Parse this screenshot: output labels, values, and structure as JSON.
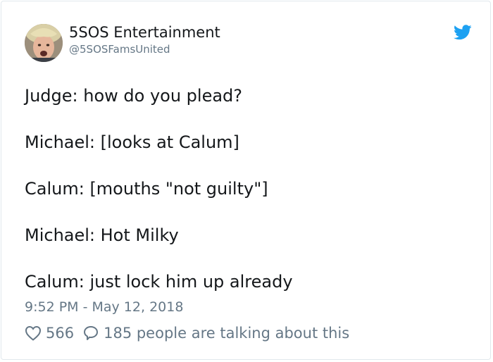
{
  "author": {
    "display_name": "5SOS Entertainment",
    "handle": "@5SOSFamsUnited",
    "avatar_icon": "avatar-photo",
    "brand_icon": "twitter-bird-icon",
    "brand_color": "#1da1f2"
  },
  "tweet": {
    "lines": [
      "Judge: how do you plead?",
      "Michael: [looks at Calum]",
      "Calum: [mouths \"not guilty\"]",
      "Michael: Hot Milky",
      "Calum: just lock him up already"
    ],
    "timestamp": "9:52 PM - May 12, 2018"
  },
  "actions": {
    "like_icon": "heart-icon",
    "like_count": "566",
    "reply_icon": "speech-bubble-icon",
    "talking_text": "185 people are talking about this"
  },
  "colors": {
    "text": "#14171a",
    "secondary": "#657786",
    "border": "#e1e8ed"
  }
}
